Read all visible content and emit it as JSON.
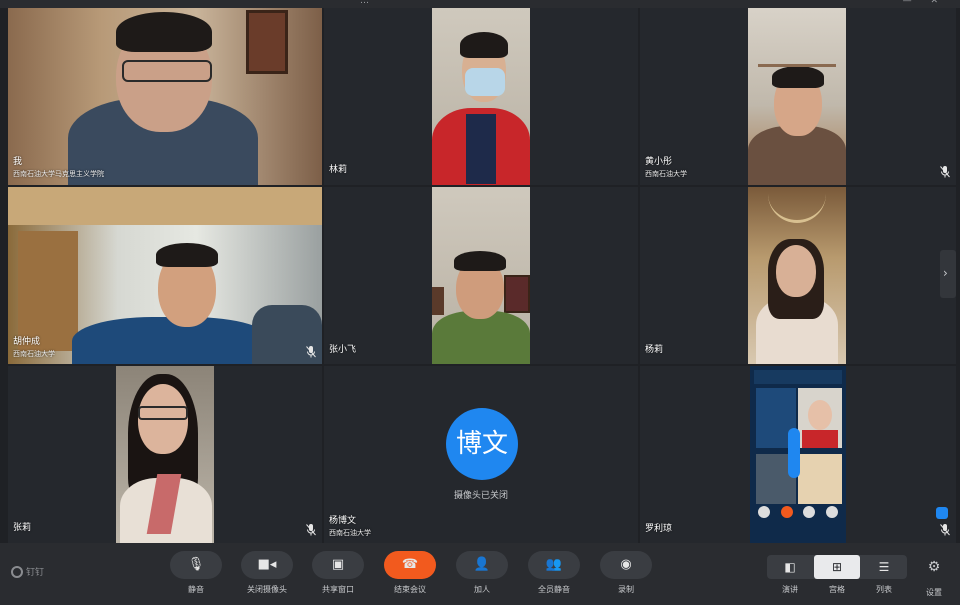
{
  "window": {
    "title": "…"
  },
  "participants": [
    {
      "name": "我",
      "org": "西南石油大学马克思主义学院",
      "camera": "on",
      "mic": "hidden"
    },
    {
      "name": "林莉",
      "org": "",
      "camera": "on",
      "mic": "hidden"
    },
    {
      "name": "黄小彤",
      "org": "西南石油大学",
      "camera": "on",
      "mic": "muted"
    },
    {
      "name": "胡仲成",
      "org": "西南石油大学",
      "camera": "on",
      "mic": "muted"
    },
    {
      "name": "张小飞",
      "org": "",
      "camera": "on",
      "mic": "hidden"
    },
    {
      "name": "杨莉",
      "org": "",
      "camera": "on",
      "mic": "hidden"
    },
    {
      "name": "张莉",
      "org": "",
      "camera": "on",
      "mic": "muted"
    },
    {
      "name": "杨博文",
      "org": "西南石油大学",
      "camera": "off",
      "avatar_text": "博文",
      "status_text": "摄像头已关闭",
      "mic": "hidden"
    },
    {
      "name": "罗利琼",
      "org": "",
      "camera": "on",
      "mic": "muted"
    }
  ],
  "toolbar": {
    "logo_text": "钉钉",
    "buttons": [
      {
        "label": "静音",
        "icon": "microphone-icon"
      },
      {
        "label": "关闭摄像头",
        "icon": "camera-icon"
      },
      {
        "label": "共享窗口",
        "icon": "share-screen-icon"
      },
      {
        "label": "结束会议",
        "icon": "hang-up-icon",
        "color": "#f25a1e"
      },
      {
        "label": "加人",
        "icon": "add-person-icon"
      },
      {
        "label": "全员静音",
        "icon": "mute-all-icon"
      },
      {
        "label": "录制",
        "icon": "record-icon"
      }
    ],
    "layouts": [
      {
        "label": "演讲",
        "icon": "speaker-layout-icon",
        "selected": false
      },
      {
        "label": "宫格",
        "icon": "grid-layout-icon",
        "selected": true
      },
      {
        "label": "列表",
        "icon": "list-layout-icon",
        "selected": false
      }
    ],
    "settings_label": "设置"
  },
  "colors": {
    "accent": "#1f87f0",
    "end_call": "#f25a1e",
    "background": "#1f2125"
  }
}
